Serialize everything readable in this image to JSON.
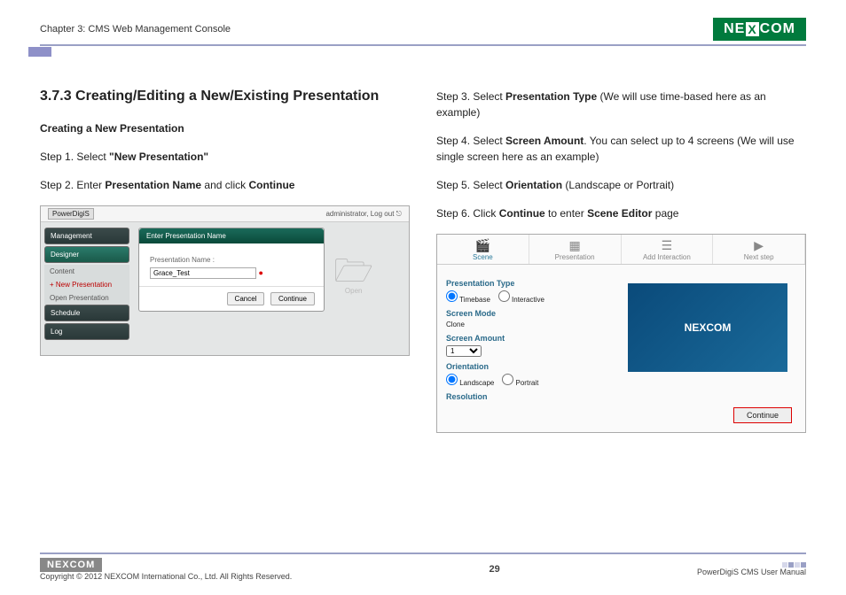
{
  "header": {
    "chapter": "Chapter 3: CMS Web Management Console",
    "logo_text": "NEXCOM"
  },
  "section": {
    "title": "3.7.3 Creating/Editing a New/Existing Presentation",
    "subtitle": "Creating a New Presentation"
  },
  "left_steps": {
    "s1_a": "Step 1. Select ",
    "s1_b": "\"New Presentation\"",
    "s2_a": "Step 2. Enter ",
    "s2_b": "Presentation Name",
    "s2_c": " and click ",
    "s2_d": "Continue"
  },
  "right_steps": {
    "s3_a": "Step 3. Select ",
    "s3_b": "Presentation Type",
    "s3_c": " (We will use time-based here as an example)",
    "s4_a": "Step 4. Select ",
    "s4_b": "Screen Amount",
    "s4_c": ". You can select up to 4 screens (We will use single screen here as an example)",
    "s5_a": "Step 5. Select ",
    "s5_b": "Orientation",
    "s5_c": " (Landscape or Portrait)",
    "s6_a": "Step 6. Click ",
    "s6_b": "Continue",
    "s6_c": " to enter ",
    "s6_d": "Scene Editor",
    "s6_e": " page"
  },
  "shot1": {
    "brand": "PowerDigiS",
    "login_user": "administrator,",
    "login_logout": "Log out",
    "side": {
      "management": "Management",
      "designer": "Designer",
      "content": "Content",
      "new_pres": "+ New Presentation",
      "open_pres": "Open Presentation",
      "schedule": "Schedule",
      "log": "Log"
    },
    "modal": {
      "title": "Enter Presentation Name",
      "label": "Presentation Name :",
      "value": "Grace_Test",
      "cancel": "Cancel",
      "continue": "Continue"
    },
    "folder_label": "Open"
  },
  "shot2": {
    "tabs": {
      "scene": "Scene",
      "presentation": "Presentation",
      "add_int": "Add Interaction",
      "next_step": "Next step"
    },
    "panel": {
      "type_h": "Presentation Type",
      "timebase": "Timebase",
      "interactive": "Interactive",
      "mode_h": "Screen Mode",
      "clone": "Clone",
      "amount_h": "Screen Amount",
      "amount_val": "1",
      "orient_h": "Orientation",
      "landscape": "Landscape",
      "portrait": "Portrait",
      "res_h": "Resolution"
    },
    "preview_logo": "NEXCOM",
    "continue": "Continue"
  },
  "footer": {
    "logo": "NEXCOM",
    "copyright": "Copyright © 2012 NEXCOM International Co., Ltd. All Rights Reserved.",
    "page": "29",
    "manual": "PowerDigiS CMS User Manual"
  }
}
